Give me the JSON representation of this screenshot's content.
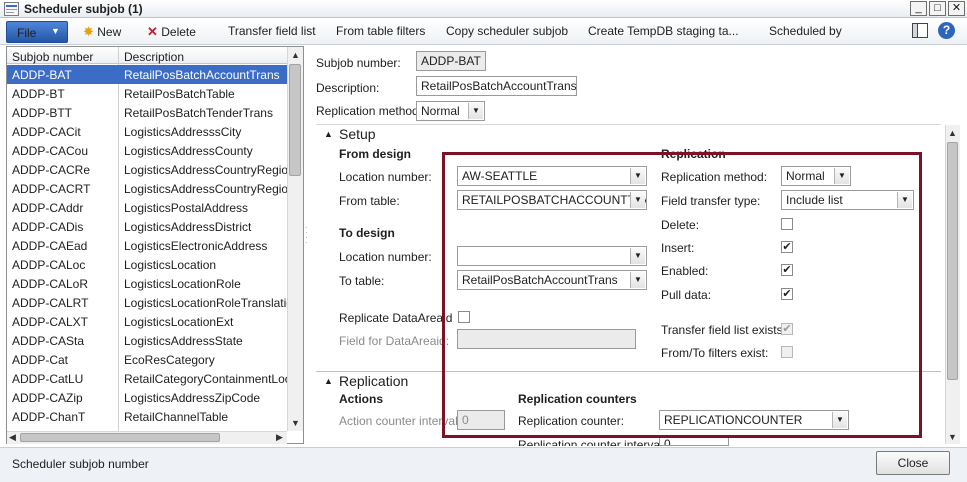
{
  "window": {
    "title": "Scheduler subjob (1)",
    "buttons": {
      "minimize": "_",
      "maximize": "□",
      "close": "✕"
    }
  },
  "toolbar": {
    "file": "File",
    "new": "New",
    "delete": "Delete",
    "transfer_field_list": "Transfer field list",
    "from_table_filters": "From table filters",
    "copy_scheduler_subjob": "Copy scheduler subjob",
    "create_tempdb": "Create TempDB staging ta...",
    "scheduled_by": "Scheduled by",
    "help": "?"
  },
  "list": {
    "headers": [
      "Subjob number",
      "Description"
    ],
    "rows": [
      [
        "ADDP-BAT",
        "RetailPosBatchAccountTrans"
      ],
      [
        "ADDP-BT",
        "RetailPosBatchTable"
      ],
      [
        "ADDP-BTT",
        "RetailPosBatchTenderTrans"
      ],
      [
        "ADDP-CACit",
        "LogisticsAddresssCity"
      ],
      [
        "ADDP-CACou",
        "LogisticsAddressCounty"
      ],
      [
        "ADDP-CACRe",
        "LogisticsAddressCountryRegion"
      ],
      [
        "ADDP-CACRT",
        "LogisticsAddressCountryRegionTra"
      ],
      [
        "ADDP-CAddr",
        "LogisticsPostalAddress"
      ],
      [
        "ADDP-CADis",
        "LogisticsAddressDistrict"
      ],
      [
        "ADDP-CAEad",
        "LogisticsElectronicAddress"
      ],
      [
        "ADDP-CALoc",
        "LogisticsLocation"
      ],
      [
        "ADDP-CALoR",
        "LogisticsLocationRole"
      ],
      [
        "ADDP-CALRT",
        "LogisticsLocationRoleTranslation"
      ],
      [
        "ADDP-CALXT",
        "LogisticsLocationExt"
      ],
      [
        "ADDP-CASta",
        "LogisticsAddressState"
      ],
      [
        "ADDP-Cat",
        "EcoResCategory"
      ],
      [
        "ADDP-CatLU",
        "RetailCategoryContainmentLookup"
      ],
      [
        "ADDP-CAZip",
        "LogisticsAddressZipCode"
      ],
      [
        "ADDP-ChanT",
        "RetailChannelTable"
      ]
    ]
  },
  "header": {
    "subjob_number_label": "Subjob number:",
    "subjob_number_value": "ADDP-BAT",
    "description_label": "Description:",
    "description_value": "RetailPosBatchAccountTrans",
    "replication_method_label": "Replication method:",
    "replication_method_value": "Normal"
  },
  "setup": {
    "title": "Setup",
    "from_design": {
      "title": "From design",
      "location_label": "Location number:",
      "location_value": "AW-SEATTLE",
      "table_label": "From table:",
      "table_value": "RETAILPOSBATCHACCOUNTTRANS"
    },
    "to_design": {
      "title": "To design",
      "location_label": "Location number:",
      "location_value": "",
      "table_label": "To table:",
      "table_value": "RetailPosBatchAccountTrans"
    },
    "replicate_dataareaid_label": "Replicate DataAreaid",
    "field_for_dataareaid_label": "Field for DataAreaid:",
    "replication": {
      "title": "Replication",
      "method_label": "Replication method:",
      "method_value": "Normal",
      "field_transfer_label": "Field transfer type:",
      "field_transfer_value": "Include list",
      "delete_label": "Delete:",
      "insert_label": "Insert:",
      "enabled_label": "Enabled:",
      "pull_data_label": "Pull data:",
      "transfer_field_list_exists_label": "Transfer field list exists:",
      "from_to_filters_exist_label": "From/To filters exist:",
      "check_mark": "✔"
    }
  },
  "replication_section": {
    "title": "Replication",
    "actions_title": "Actions",
    "action_counter_label": "Action counter interval:",
    "action_counter_value": "0",
    "counters_title": "Replication counters",
    "counter_label": "Replication counter:",
    "counter_value": "REPLICATIONCOUNTER",
    "counter_interval_label": "Replication counter interval:",
    "counter_interval_value": "0"
  },
  "status": {
    "text": "Scheduler subjob number",
    "close_label": "Close"
  },
  "colors": {
    "selection": "#3b6dc7",
    "highlight_border": "#7d1128",
    "file_button": "#2f66bd"
  }
}
